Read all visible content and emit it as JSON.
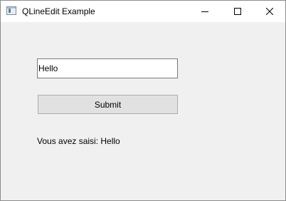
{
  "window": {
    "title": "QLineEdit Example",
    "app_icon": "qt-app-icon",
    "controls": {
      "minimize_icon": "minimize-icon",
      "maximize_icon": "maximize-icon",
      "close_icon": "close-icon"
    }
  },
  "form": {
    "line_edit_value": "Hello",
    "submit_label": "Submit",
    "result_text": "Vous avez saisi: Hello"
  }
}
